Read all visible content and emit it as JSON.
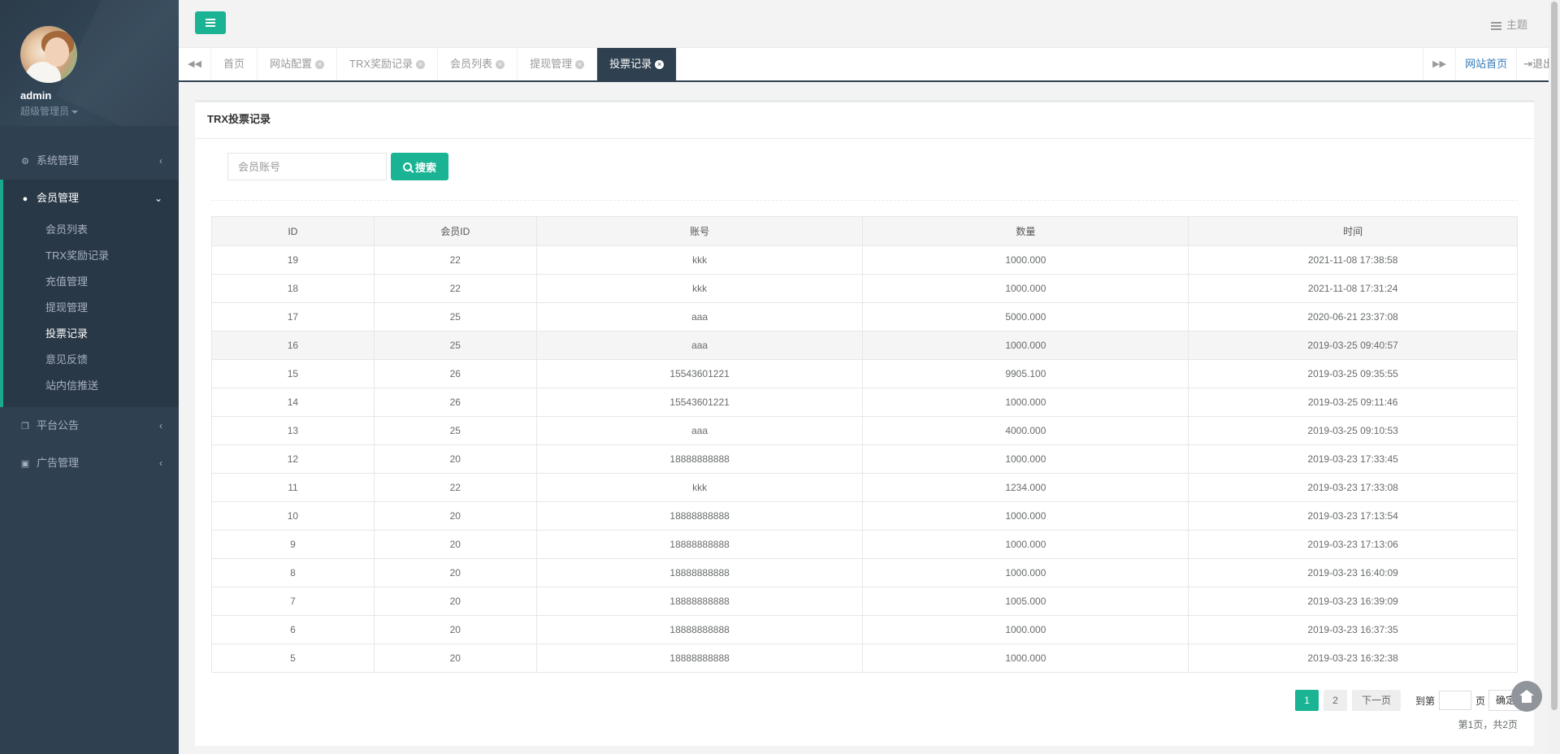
{
  "user": {
    "name": "admin",
    "role": "超级管理员"
  },
  "sidebar": {
    "groups": [
      {
        "label": "系统管理",
        "icon": "gear-icon"
      },
      {
        "label": "会员管理",
        "icon": "users-icon",
        "items": [
          {
            "label": "会员列表"
          },
          {
            "label": "TRX奖励记录"
          },
          {
            "label": "充值管理"
          },
          {
            "label": "提现管理"
          },
          {
            "label": "投票记录"
          },
          {
            "label": "意见反馈"
          },
          {
            "label": "站内信推送"
          }
        ]
      },
      {
        "label": "平台公告",
        "icon": "copy-icon"
      },
      {
        "label": "广告管理",
        "icon": "image-icon"
      }
    ]
  },
  "header": {
    "theme_label": "主题"
  },
  "tabs": {
    "items": [
      {
        "label": "首页"
      },
      {
        "label": "网站配置"
      },
      {
        "label": "TRX奖励记录"
      },
      {
        "label": "会员列表"
      },
      {
        "label": "提现管理"
      },
      {
        "label": "投票记录"
      }
    ],
    "home_link": "网站首页",
    "logout": "退出"
  },
  "panel": {
    "title": "TRX投票记录"
  },
  "search": {
    "placeholder": "会员账号",
    "button": "搜索"
  },
  "table": {
    "headers": [
      "ID",
      "会员ID",
      "账号",
      "数量",
      "时间"
    ],
    "rows": [
      [
        "19",
        "22",
        "kkk",
        "1000.000",
        "2021-11-08 17:38:58"
      ],
      [
        "18",
        "22",
        "kkk",
        "1000.000",
        "2021-11-08 17:31:24"
      ],
      [
        "17",
        "25",
        "aaa",
        "5000.000",
        "2020-06-21 23:37:08"
      ],
      [
        "16",
        "25",
        "aaa",
        "1000.000",
        "2019-03-25 09:40:57"
      ],
      [
        "15",
        "26",
        "15543601221",
        "9905.100",
        "2019-03-25 09:35:55"
      ],
      [
        "14",
        "26",
        "15543601221",
        "1000.000",
        "2019-03-25 09:11:46"
      ],
      [
        "13",
        "25",
        "aaa",
        "4000.000",
        "2019-03-25 09:10:53"
      ],
      [
        "12",
        "20",
        "18888888888",
        "1000.000",
        "2019-03-23 17:33:45"
      ],
      [
        "11",
        "22",
        "kkk",
        "1234.000",
        "2019-03-23 17:33:08"
      ],
      [
        "10",
        "20",
        "18888888888",
        "1000.000",
        "2019-03-23 17:13:54"
      ],
      [
        "9",
        "20",
        "18888888888",
        "1000.000",
        "2019-03-23 17:13:06"
      ],
      [
        "8",
        "20",
        "18888888888",
        "1000.000",
        "2019-03-23 16:40:09"
      ],
      [
        "7",
        "20",
        "18888888888",
        "1005.000",
        "2019-03-23 16:39:09"
      ],
      [
        "6",
        "20",
        "18888888888",
        "1000.000",
        "2019-03-23 16:37:35"
      ],
      [
        "5",
        "20",
        "18888888888",
        "1000.000",
        "2019-03-23 16:32:38"
      ]
    ]
  },
  "pagination": {
    "pages": [
      "1",
      "2"
    ],
    "next": "下一页",
    "goto_prefix": "到第",
    "goto_suffix": "页",
    "confirm": "确定",
    "summary": "第1页，共2页"
  },
  "colors": {
    "accent": "#1ab394",
    "sidebar": "#2f4050"
  }
}
